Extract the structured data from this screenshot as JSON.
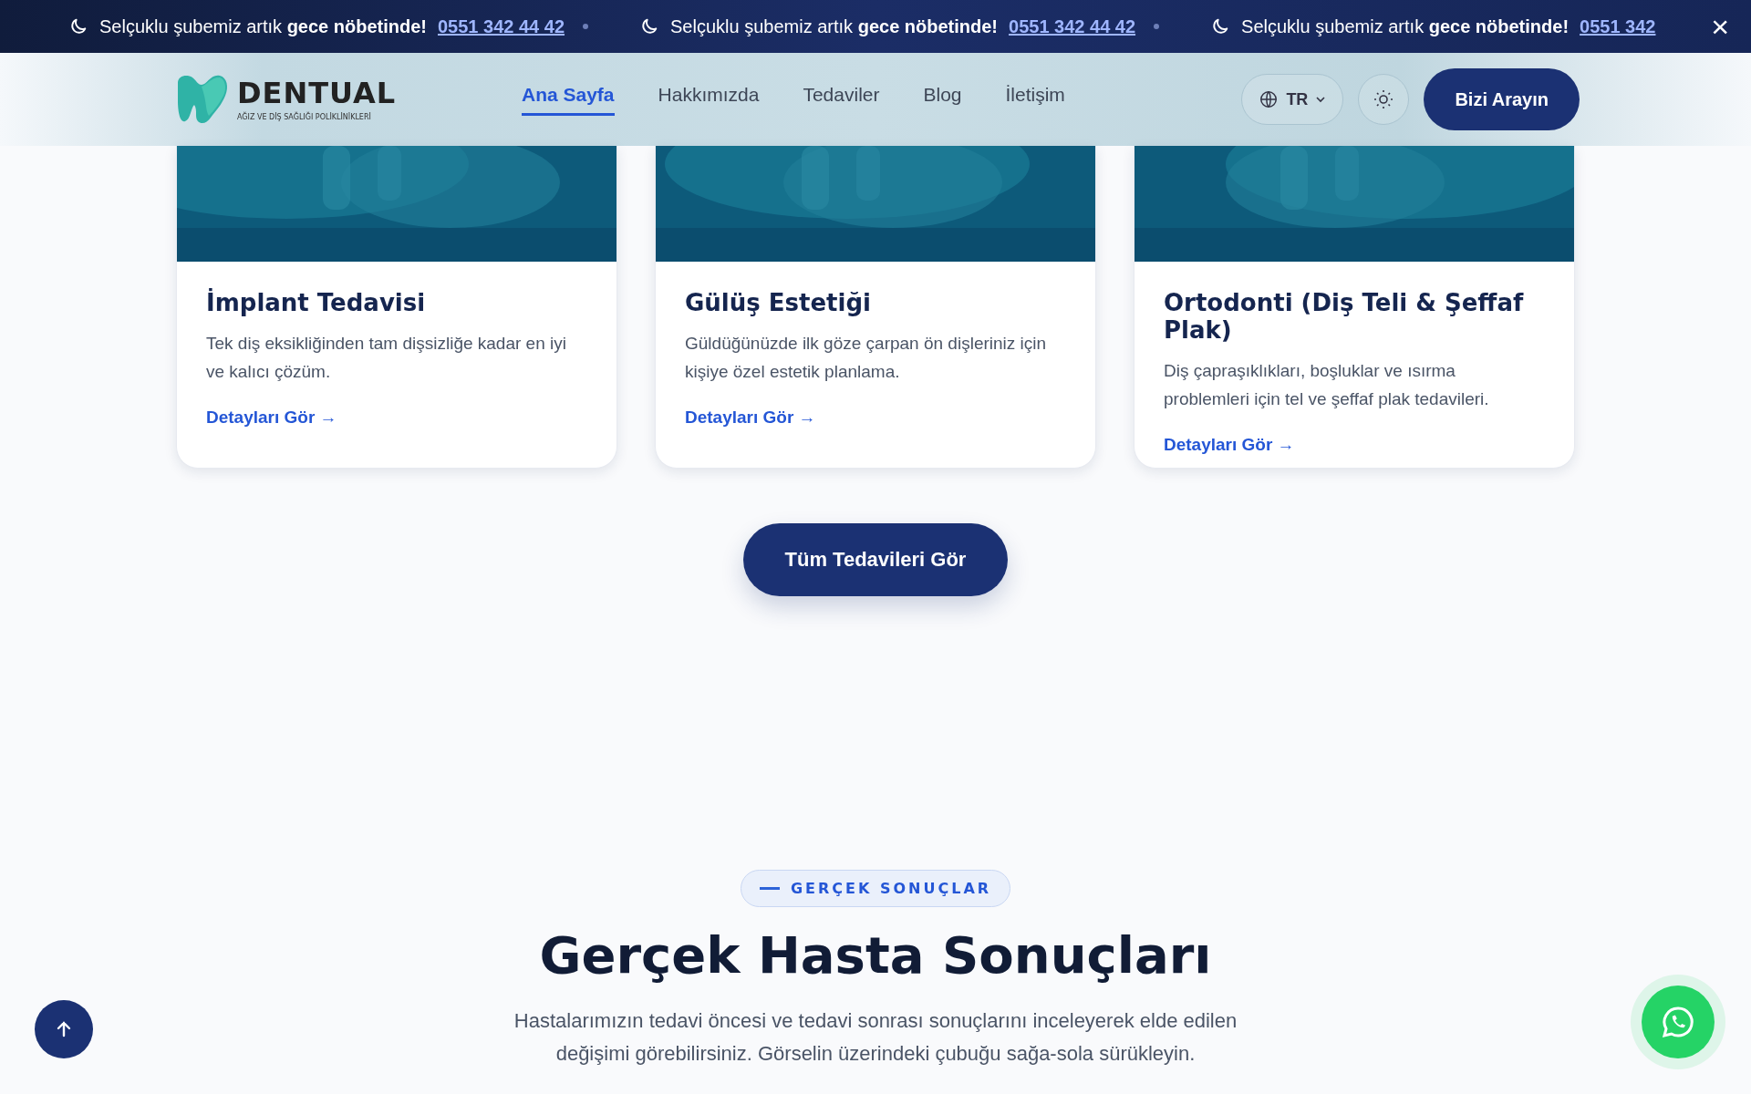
{
  "announcement_bar": {
    "items": [
      {
        "text": "Selçuklu şubemiz artık **gece nöbetinde!**",
        "phone": "0551 342 44 42"
      },
      {
        "text": "Selçuklu şubemiz artık **gece nöbetinde!**",
        "phone": "0551 342 44 42"
      },
      {
        "text": "Selçuklu şubemiz artık **gece nöbetinde!**",
        "phone": "0551 342"
      }
    ],
    "close": "×"
  },
  "header": {
    "logo": {
      "name": "DENTUAL",
      "tagline": "AĞIZ VE DİŞ SAĞLIĞI POLİKLİNİKLERİ"
    },
    "nav": [
      {
        "label": "Ana Sayfa",
        "selected": true
      },
      {
        "label": "Hakkımızda",
        "selected": false
      },
      {
        "label": "Tedaviler",
        "selected": false
      },
      {
        "label": "Blog",
        "selected": false
      },
      {
        "label": "İletişim",
        "selected": false
      }
    ],
    "language": "TR",
    "cta": "Bizi Arayın"
  },
  "treatments": [
    {
      "title": "İmplant Tedavisi",
      "description": "Tek diş eksikliğinden tam dişsizliğe kadar en iyi ve kalıcı çözüm.",
      "link": "Detayları Gör →"
    },
    {
      "title": "Gülüş Estetiği",
      "description": "Güldüğünüzde ilk göze çarpan ön dişleriniz için kişiye özel estetik planlama.",
      "link": "Detayları Gör →"
    },
    {
      "title": "Ortodonti (Diş Teli & Şeffaf Plak)",
      "description": "Diş çapraşıklıkları, boşluklar ve ısırma problemleri için tel ve şeffaf plak tedavileri.",
      "link": "Detayları Gör →"
    }
  ],
  "all_treatments_button": "Tüm Tedavileri Gör",
  "results_section": {
    "badge": "GERÇEK SONUÇLAR",
    "title": "Gerçek Hasta Sonuçları",
    "description": "Hastalarımızın tedavi öncesi ve tedavi sonrası sonuçlarını inceleyerek elde edilen değişimi görebilirsiniz. Görselin üzerindeki çubuğu sağa-sola sürükleyin."
  }
}
